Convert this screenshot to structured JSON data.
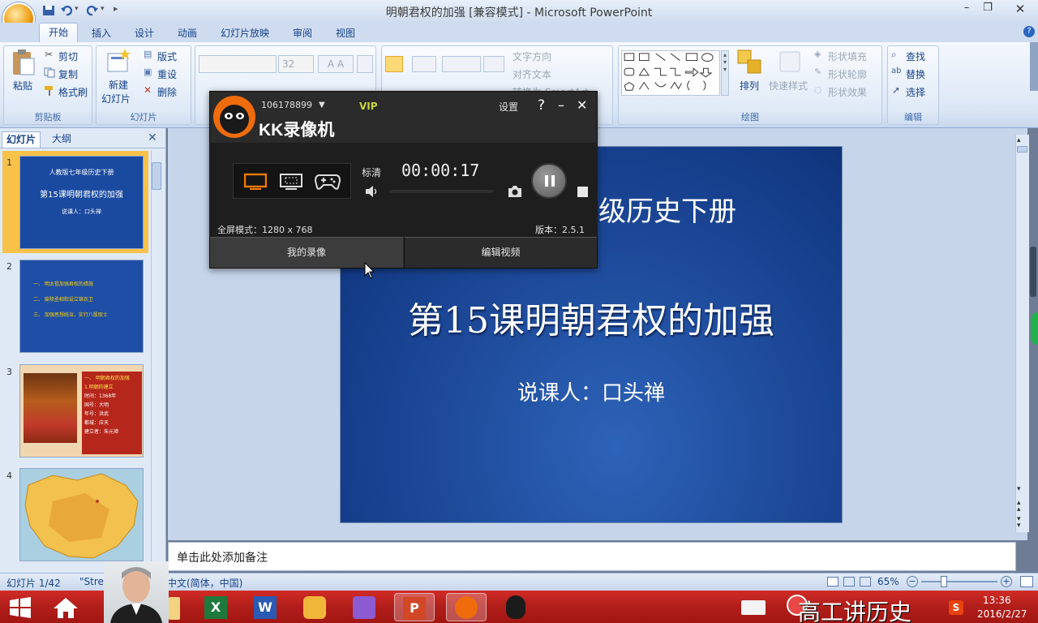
{
  "window": {
    "title": "明朝君权的加强 [兼容模式] - Microsoft PowerPoint"
  },
  "tabs": [
    "开始",
    "插入",
    "设计",
    "动画",
    "幻灯片放映",
    "审阅",
    "视图"
  ],
  "ribbon": {
    "clipboard": {
      "paste": "粘贴",
      "cut": "剪切",
      "copy": "复制",
      "format_painter": "格式刷",
      "label": "剪贴板"
    },
    "slides": {
      "new_slide_1": "新建",
      "new_slide_2": "幻灯片",
      "layout": "版式",
      "reset": "重设",
      "delete": "删除",
      "label": "幻灯片"
    },
    "font": {
      "size": "32"
    },
    "paragraph": {
      "text_direction": "文字方向",
      "align_text": "对齐文本",
      "smartart": "转换为 SmartArt"
    },
    "drawing": {
      "arrange": "排列",
      "quick_styles": "快速样式",
      "shape_fill": "形状填充",
      "shape_outline": "形状轮廓",
      "shape_effects": "形状效果",
      "label": "绘图"
    },
    "editing": {
      "find": "查找",
      "replace": "替换",
      "select": "选择",
      "label": "编辑"
    }
  },
  "left_pane": {
    "tab_slides": "幻灯片",
    "tab_outline": "大纲",
    "thumbs": [
      {
        "num": "1",
        "line1": "人教版七年级历史下册",
        "line2": "第15课明朝君权的加强",
        "line3": "说课人：口头禅"
      },
      {
        "num": "2",
        "items": [
          "一、 明太祖加强君权的措施",
          "二、 废除丞相和设立锦衣卫",
          "三、 加强思想统治，实行八股取士"
        ]
      },
      {
        "num": "3",
        "heading": "一、 明朝君权的加强",
        "sub": "1.明朝的建立",
        "lines": [
          "时间：1368年",
          "国号：大明",
          "年号：洪武",
          "都城：应天",
          "建立者：朱元璋"
        ]
      },
      {
        "num": "4"
      }
    ]
  },
  "slide": {
    "line1": "人教版七年级历史下册",
    "line1_visible": "级历史下册",
    "title": "第15课明朝君权的加强",
    "speaker": "说课人：口头禅"
  },
  "notes": {
    "placeholder": "单击此处添加备注"
  },
  "status": {
    "slide_count": "幻灯片 1/42",
    "theme": "\"Stre",
    "language": "中文(简体，中国)",
    "zoom": "65%"
  },
  "kk": {
    "account": "106178899",
    "vip": "VIP",
    "settings": "设置",
    "help": "?",
    "app_name": "KK录像机",
    "quality": "标清",
    "timer": "00:00:17",
    "fullscreen": "全屏模式：1280 x 768",
    "version": "版本：2.5.1",
    "my_recordings": "我的录像",
    "edit_video": "编辑视频"
  },
  "taskbar": {
    "time": "13:36",
    "date": "2016/2/27",
    "overlay_text": "高工讲历史"
  },
  "colors": {
    "ribbon": "#dbe6f5",
    "slide_bg": "#1e4a9a",
    "taskbar": "#b01e1a",
    "kk_bg": "#2b2b2b",
    "thumb_highlight": "#f8c24a"
  }
}
